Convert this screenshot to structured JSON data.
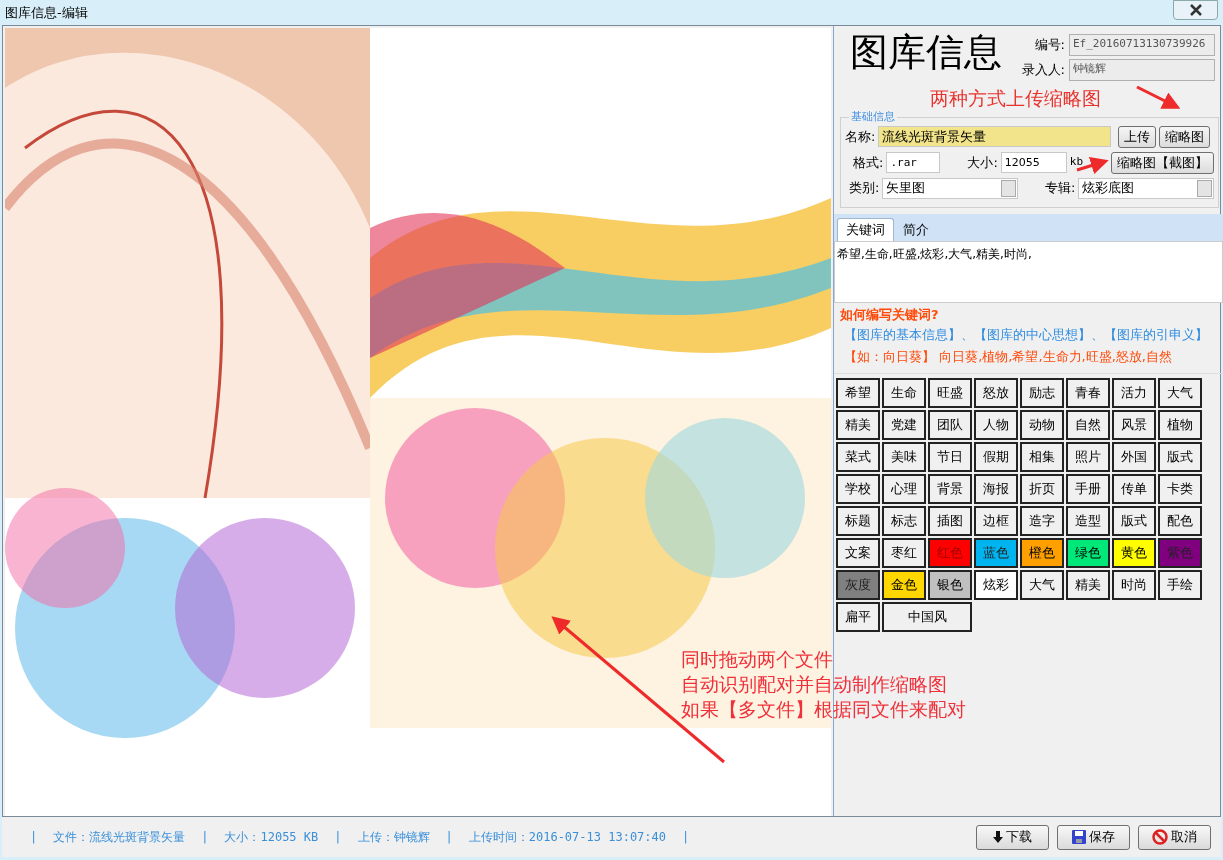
{
  "window": {
    "title": "图库信息-编辑"
  },
  "header": {
    "title": "图库信息",
    "fields": [
      {
        "label": "编号:",
        "value": "Ef_20160713130739926"
      },
      {
        "label": "录入人:",
        "value": "钟镜辉"
      }
    ]
  },
  "upload_note": "两种方式上传缩略图",
  "basic_info": {
    "legend": "基础信息",
    "name": {
      "label": "名称:",
      "value": "流线光斑背景矢量"
    },
    "upload_button": "上传",
    "thumb_button": "缩略图",
    "format": {
      "label": "格式:",
      "value": ".rar"
    },
    "size": {
      "label": "大小:",
      "value": "12055",
      "unit": "kb"
    },
    "capture_button": "缩略图【截图】",
    "category": {
      "label": "类别:",
      "value": "矢里图"
    },
    "album": {
      "label": "专辑:",
      "value": "炫彩底图"
    }
  },
  "tabs": [
    {
      "label": "关键词",
      "selected": true
    },
    {
      "label": "简介",
      "selected": false
    }
  ],
  "keywords_text": "希望,生命,旺盛,炫彩,大气,精美,时尚,",
  "hint": {
    "title": "如何编写关键词?",
    "line1": "【图库的基本信息】、【图库的中心思想】、【图库的引申义】",
    "line2": "【如：向日葵】 向日葵,植物,希望,生命力,旺盛,怒放,自然"
  },
  "keyword_buttons": [
    {
      "label": "希望",
      "color": "#f0f0f0"
    },
    {
      "label": "生命",
      "color": "#f0f0f0"
    },
    {
      "label": "旺盛",
      "color": "#f0f0f0"
    },
    {
      "label": "怒放",
      "color": "#f0f0f0"
    },
    {
      "label": "励志",
      "color": "#f0f0f0"
    },
    {
      "label": "青春",
      "color": "#f0f0f0"
    },
    {
      "label": "活力",
      "color": "#f0f0f0"
    },
    {
      "label": "大气",
      "color": "#f0f0f0"
    },
    {
      "label": "精美",
      "color": "#f0f0f0"
    },
    {
      "label": "党建",
      "color": "#f0f0f0"
    },
    {
      "label": "团队",
      "color": "#f0f0f0"
    },
    {
      "label": "人物",
      "color": "#f0f0f0"
    },
    {
      "label": "动物",
      "color": "#f0f0f0"
    },
    {
      "label": "自然",
      "color": "#f0f0f0"
    },
    {
      "label": "风景",
      "color": "#f0f0f0"
    },
    {
      "label": "植物",
      "color": "#f0f0f0"
    },
    {
      "label": "菜式",
      "color": "#f0f0f0"
    },
    {
      "label": "美味",
      "color": "#f0f0f0"
    },
    {
      "label": "节日",
      "color": "#f0f0f0"
    },
    {
      "label": "假期",
      "color": "#f0f0f0"
    },
    {
      "label": "相集",
      "color": "#f0f0f0"
    },
    {
      "label": "照片",
      "color": "#f0f0f0"
    },
    {
      "label": "外国",
      "color": "#f0f0f0"
    },
    {
      "label": "版式",
      "color": "#f0f0f0"
    },
    {
      "label": "学校",
      "color": "#f0f0f0"
    },
    {
      "label": "心理",
      "color": "#f0f0f0"
    },
    {
      "label": "背景",
      "color": "#f0f0f0"
    },
    {
      "label": "海报",
      "color": "#f0f0f0"
    },
    {
      "label": "折页",
      "color": "#f0f0f0"
    },
    {
      "label": "手册",
      "color": "#f0f0f0"
    },
    {
      "label": "传单",
      "color": "#f0f0f0"
    },
    {
      "label": "卡类",
      "color": "#f0f0f0"
    },
    {
      "label": "标题",
      "color": "#f0f0f0"
    },
    {
      "label": "标志",
      "color": "#f0f0f0"
    },
    {
      "label": "插图",
      "color": "#f0f0f0"
    },
    {
      "label": "边框",
      "color": "#f0f0f0"
    },
    {
      "label": "造字",
      "color": "#f0f0f0"
    },
    {
      "label": "造型",
      "color": "#f0f0f0"
    },
    {
      "label": "版式",
      "color": "#f0f0f0"
    },
    {
      "label": "配色",
      "color": "#f0f0f0"
    },
    {
      "label": "文案",
      "color": "#f0f0f0"
    },
    {
      "label": "枣红",
      "color": "#f0f0f0"
    },
    {
      "label": "红色",
      "color": "#ff0000"
    },
    {
      "label": "蓝色",
      "color": "#00b4f0"
    },
    {
      "label": "橙色",
      "color": "#ffa000"
    },
    {
      "label": "绿色",
      "color": "#00e878"
    },
    {
      "label": "黄色",
      "color": "#ffff00"
    },
    {
      "label": "紫色",
      "color": "#800080"
    },
    {
      "label": "灰度",
      "color": "#808080"
    },
    {
      "label": "金色",
      "color": "#ffd700"
    },
    {
      "label": "银色",
      "color": "#c0c0c0"
    },
    {
      "label": "炫彩",
      "color": "#ffffff"
    },
    {
      "label": "大气",
      "color": "#f0f0f0"
    },
    {
      "label": "精美",
      "color": "#f0f0f0"
    },
    {
      "label": "时尚",
      "color": "#f0f0f0"
    },
    {
      "label": "手绘",
      "color": "#f0f0f0"
    },
    {
      "label": "扁平",
      "color": "#f0f0f0"
    },
    {
      "label": "中国风",
      "color": "#f0f0f0"
    }
  ],
  "drag_note": [
    "同时拖动两个文件",
    "自动识别配对并自动制作缩略图",
    "如果【多文件】根据同文件来配对"
  ],
  "status_bar": [
    "|",
    "文件：流线光斑背景矢量",
    "|",
    "大小：12055 KB",
    "|",
    "上传：钟镜辉",
    "|",
    "上传时间：2016-07-13 13:07:40",
    "|"
  ],
  "buttons": [
    {
      "label": "下载",
      "kind": "download"
    },
    {
      "label": "保存",
      "kind": "save"
    },
    {
      "label": "取消",
      "kind": "cancel"
    }
  ]
}
